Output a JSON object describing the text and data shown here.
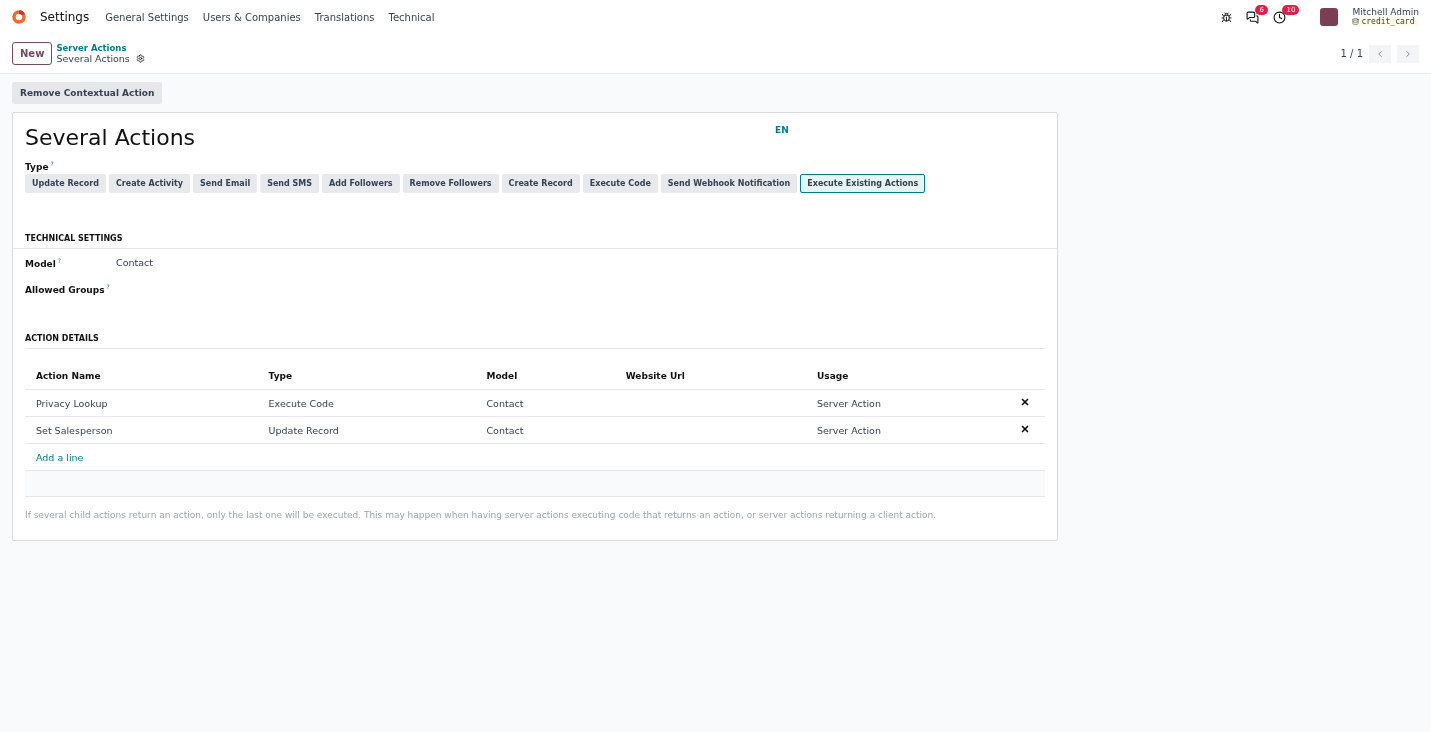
{
  "navbar": {
    "app": "Settings",
    "menus": [
      "General Settings",
      "Users & Companies",
      "Translations",
      "Technical"
    ],
    "messages_count": "6",
    "activities_count": "10",
    "user": {
      "name": "Mitchell Admin",
      "database": "credit_card"
    }
  },
  "control_panel": {
    "new_button": "New",
    "breadcrumb_parent": "Server Actions",
    "breadcrumb_current": "Several Actions",
    "pager": "1 / 1"
  },
  "header_buttons": [
    "Remove Contextual Action"
  ],
  "form": {
    "title": "Several Actions",
    "language": "EN",
    "type_label": "Type",
    "help_mark": "?",
    "types": [
      {
        "label": "Update Record",
        "selected": false
      },
      {
        "label": "Create Activity",
        "selected": false
      },
      {
        "label": "Send Email",
        "selected": false
      },
      {
        "label": "Send SMS",
        "selected": false
      },
      {
        "label": "Add Followers",
        "selected": false
      },
      {
        "label": "Remove Followers",
        "selected": false
      },
      {
        "label": "Create Record",
        "selected": false
      },
      {
        "label": "Execute Code",
        "selected": false
      },
      {
        "label": "Send Webhook Notification",
        "selected": false
      },
      {
        "label": "Execute Existing Actions",
        "selected": true
      }
    ],
    "technical_heading": "TECHNICAL SETTINGS",
    "fields": [
      {
        "label": "Model",
        "help": "?",
        "value": "Contact"
      },
      {
        "label": "Allowed Groups",
        "help": "?"
      }
    ],
    "details_heading": "ACTION DETAILS",
    "table": {
      "columns": [
        "Action Name",
        "Type",
        "Model",
        "Website Url",
        "Usage"
      ],
      "rows": [
        [
          "Privacy Lookup",
          "Execute Code",
          "Contact",
          "",
          "Server Action"
        ],
        [
          "Set Salesperson",
          "Update Record",
          "Contact",
          "",
          "Server Action"
        ]
      ],
      "add_line": "Add a line"
    },
    "note": "If several child actions return an action, only the last one will be executed. This may happen when having server actions executing code that returns an action, or server actions returning a client action."
  }
}
